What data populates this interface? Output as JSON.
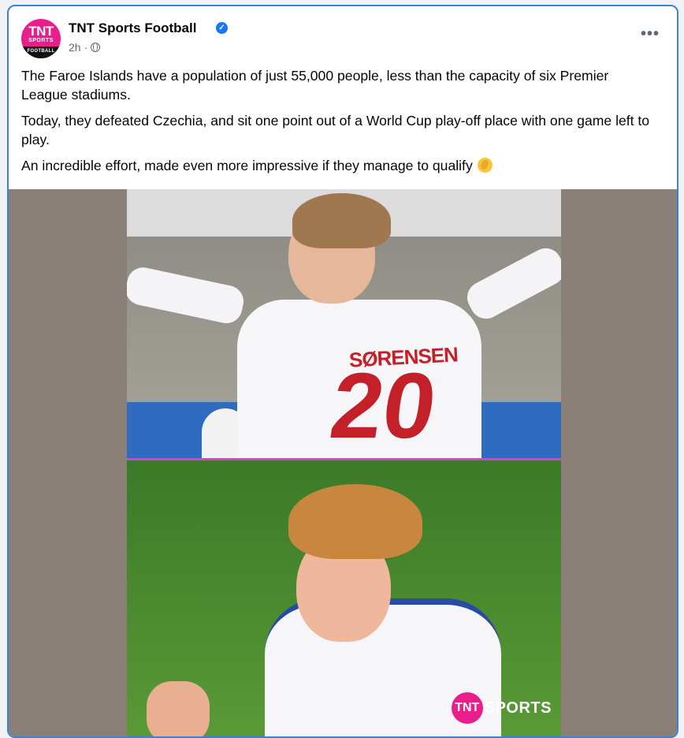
{
  "post": {
    "page_name": "TNT Sports Football",
    "avatar": {
      "line1": "TNT",
      "line2": "SPORTS",
      "line3": "FOOTBALL"
    },
    "time": "2h",
    "separator": "·",
    "verified_icon": "✓",
    "more_label": "•••",
    "paragraphs": [
      "The Faroe Islands have a population of just 55,000 people, less than the capacity of six Premier League stadiums.",
      "Today, they defeated Czechia, and sit one point out of a World Cup play-off place with one game left to play.",
      "An incredible effort, made even more impressive if they manage to qualify"
    ],
    "emoji": "clapping-hands-icon"
  },
  "media": {
    "shirt_name": "SØRENSEN",
    "shirt_number": "20",
    "watermark_logo": "TNT",
    "watermark_text": "SPORTS"
  },
  "colors": {
    "accent": "#1877f2",
    "brand": "#e91e8c",
    "card_border": "#3b82d6",
    "divider": "#e23bd0",
    "shirt_red": "#c4202a"
  }
}
